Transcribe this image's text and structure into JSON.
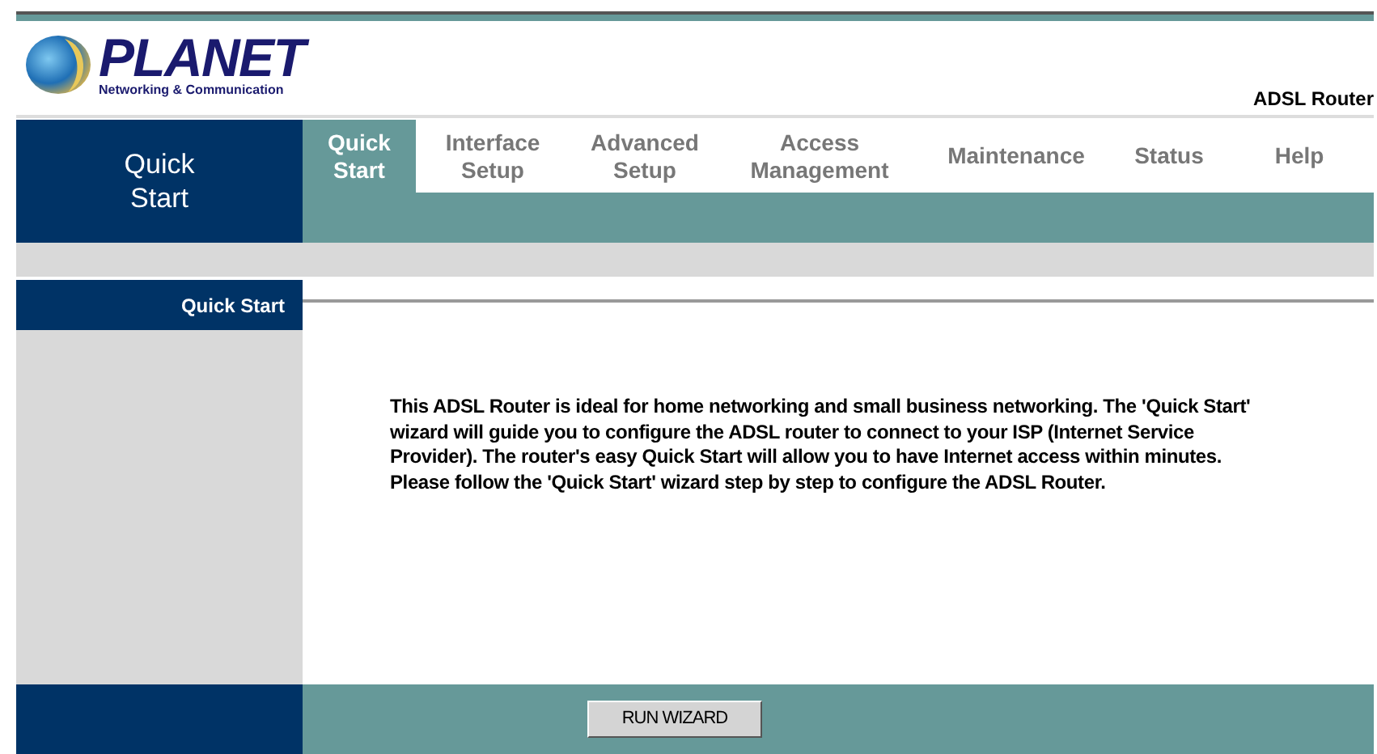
{
  "logo": {
    "brand": "PLANET",
    "tagline": "Networking & Communication"
  },
  "product": "ADSL Router",
  "section_title": "Quick Start",
  "tabs": [
    {
      "label": "Quick Start",
      "selected": true
    },
    {
      "label": "Interface Setup",
      "selected": false
    },
    {
      "label": "Advanced Setup",
      "selected": false
    },
    {
      "label": "Access Management",
      "selected": false
    },
    {
      "label": "Maintenance",
      "selected": false
    },
    {
      "label": "Status",
      "selected": false
    },
    {
      "label": "Help",
      "selected": false
    }
  ],
  "panel_title": "Quick Start",
  "description": "This ADSL Router is ideal for home networking and small business networking. The 'Quick Start' wizard will guide you to configure the ADSL router to connect to your ISP (Internet Service Provider). The router's easy Quick Start will allow you to have Internet access within minutes. Please follow the 'Quick Start' wizard step by step to configure the ADSL Router.",
  "button": "RUN WIZARD"
}
